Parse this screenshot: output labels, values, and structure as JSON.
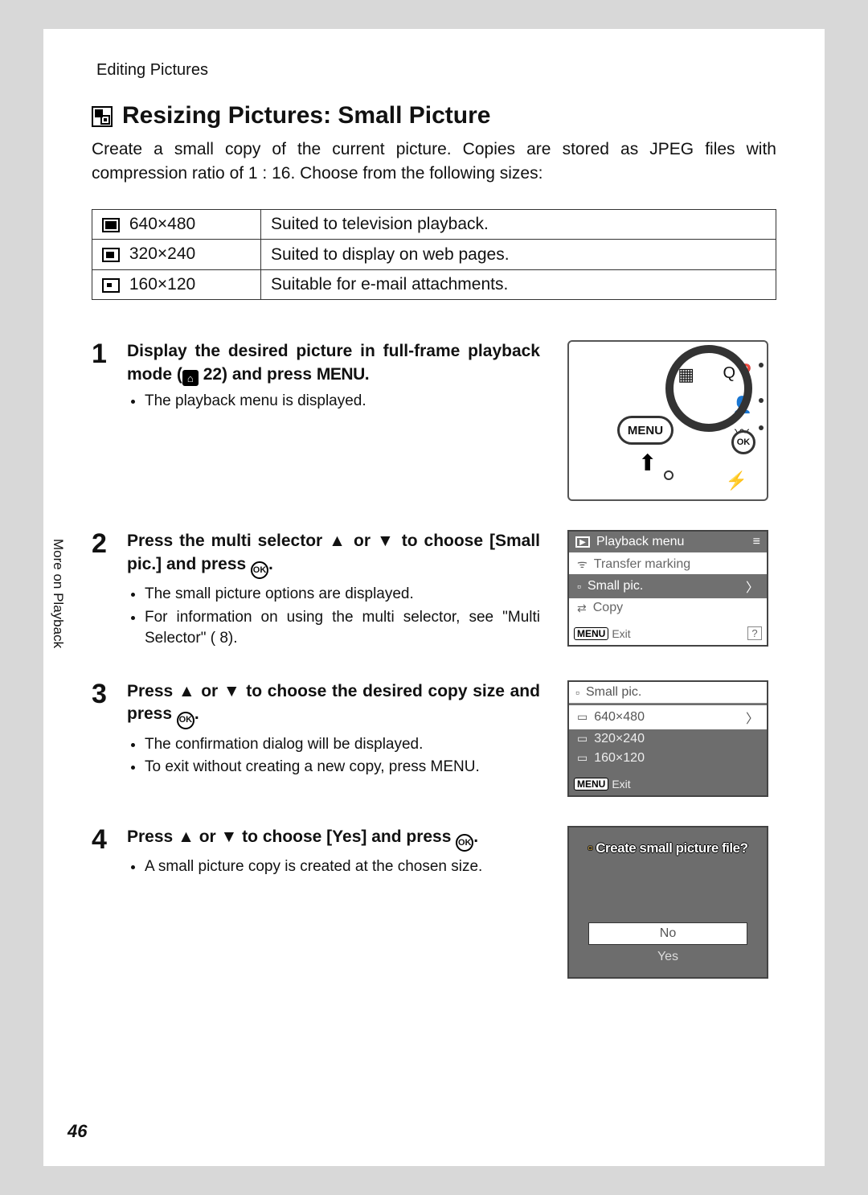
{
  "crumb": "Editing Pictures",
  "title": "Resizing Pictures: Small Picture",
  "intro": "Create a small copy of the current picture. Copies are stored as JPEG files with compression ratio of 1 : 16. Choose from the following sizes:",
  "size_table": [
    {
      "size": "640×480",
      "desc": "Suited to television playback."
    },
    {
      "size": "320×240",
      "desc": "Suited to display on web pages."
    },
    {
      "size": "160×120",
      "desc": "Suitable for e-mail attachments."
    }
  ],
  "steps": {
    "s1": {
      "num": "1",
      "head_a": "Display the desired picture in full-frame playback mode (",
      "head_ref": "22",
      "head_b": ") and press ",
      "head_menu": "MENU",
      "head_c": ".",
      "bullets": [
        "The playback menu is displayed."
      ]
    },
    "s2": {
      "num": "2",
      "head_a": "Press the multi selector ",
      "head_b": " or ",
      "head_c": " to choose [Small pic.] and press ",
      "head_d": ".",
      "bullets": [
        "The small picture options are displayed.",
        "For information on using the multi selector, see \"Multi Selector\" (  8)."
      ],
      "lcd": {
        "title": "Playback menu",
        "items": [
          "Transfer marking",
          "Small pic.",
          "Copy"
        ],
        "selected_index": 1,
        "exit": "Exit",
        "menu_label": "MENU"
      }
    },
    "s3": {
      "num": "3",
      "head_a": "Press ",
      "head_b": " or ",
      "head_c": " to choose the desired copy size and press ",
      "head_d": ".",
      "bullets": [
        "The confirmation dialog will be displayed.",
        "To exit without creating a new copy, press MENU."
      ],
      "lcd": {
        "title": "Small pic.",
        "items": [
          "640×480",
          "320×240",
          "160×120"
        ],
        "selected_index": 0,
        "exit": "Exit",
        "menu_label": "MENU"
      }
    },
    "s4": {
      "num": "4",
      "head_a": "Press ",
      "head_b": " or ",
      "head_c": " to choose [Yes] and press ",
      "head_d": ".",
      "bullets": [
        "A small picture copy is created at the chosen size."
      ],
      "dialog": {
        "question": "Create small picture file?",
        "no": "No",
        "yes": "Yes"
      }
    }
  },
  "menu_btn_label": "MENU",
  "ok_label": "OK",
  "side_tab": "More on Playback",
  "page_number": "46"
}
